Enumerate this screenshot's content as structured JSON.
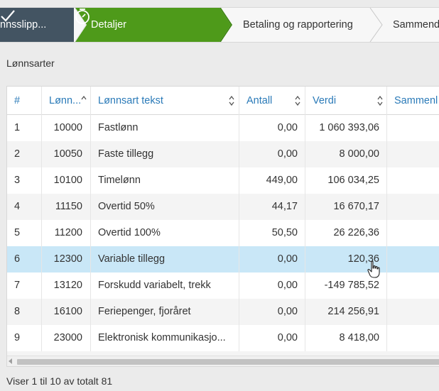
{
  "wizard": {
    "steps": [
      {
        "label": "nnsslipp...",
        "state": "done"
      },
      {
        "label": "Detaljer",
        "state": "active"
      },
      {
        "label": "Betaling og rapportering",
        "state": "todo"
      },
      {
        "label": "Sammend",
        "state": "todo"
      }
    ],
    "colors": {
      "done": "#435462",
      "active": "#4e9a1a",
      "todo": "#f7f7f7"
    }
  },
  "section_title": "Lønnsarter",
  "table": {
    "columns": [
      "#",
      "Lønn...",
      "Lønnsart tekst",
      "Antall",
      "Verdi",
      "Sammenl"
    ],
    "rows": [
      {
        "n": "1",
        "code": "10000",
        "text": "Fastlønn",
        "antall": "0,00",
        "verdi": "1 060 393,06"
      },
      {
        "n": "2",
        "code": "10050",
        "text": "Faste tillegg",
        "antall": "0,00",
        "verdi": "8 000,00"
      },
      {
        "n": "3",
        "code": "10100",
        "text": "Timelønn",
        "antall": "449,00",
        "verdi": "106 034,25"
      },
      {
        "n": "4",
        "code": "11150",
        "text": "Overtid 50%",
        "antall": "44,17",
        "verdi": "16 670,17"
      },
      {
        "n": "5",
        "code": "11200",
        "text": "Overtid 100%",
        "antall": "50,50",
        "verdi": "26 226,36"
      },
      {
        "n": "6",
        "code": "12300",
        "text": "Variable tillegg",
        "antall": "0,00",
        "verdi": "120,36"
      },
      {
        "n": "7",
        "code": "13120",
        "text": "Forskudd variabelt, trekk",
        "antall": "0,00",
        "verdi": "-149 785,52"
      },
      {
        "n": "8",
        "code": "16100",
        "text": "Feriepenger, fjoråret",
        "antall": "0,00",
        "verdi": "214 256,91"
      },
      {
        "n": "9",
        "code": "23000",
        "text": "Elektronisk kommunikasjo...",
        "antall": "0,00",
        "verdi": "8 418,00"
      }
    ],
    "selected_row": 6
  },
  "footer": "Viser 1 til 10 av totalt 81"
}
